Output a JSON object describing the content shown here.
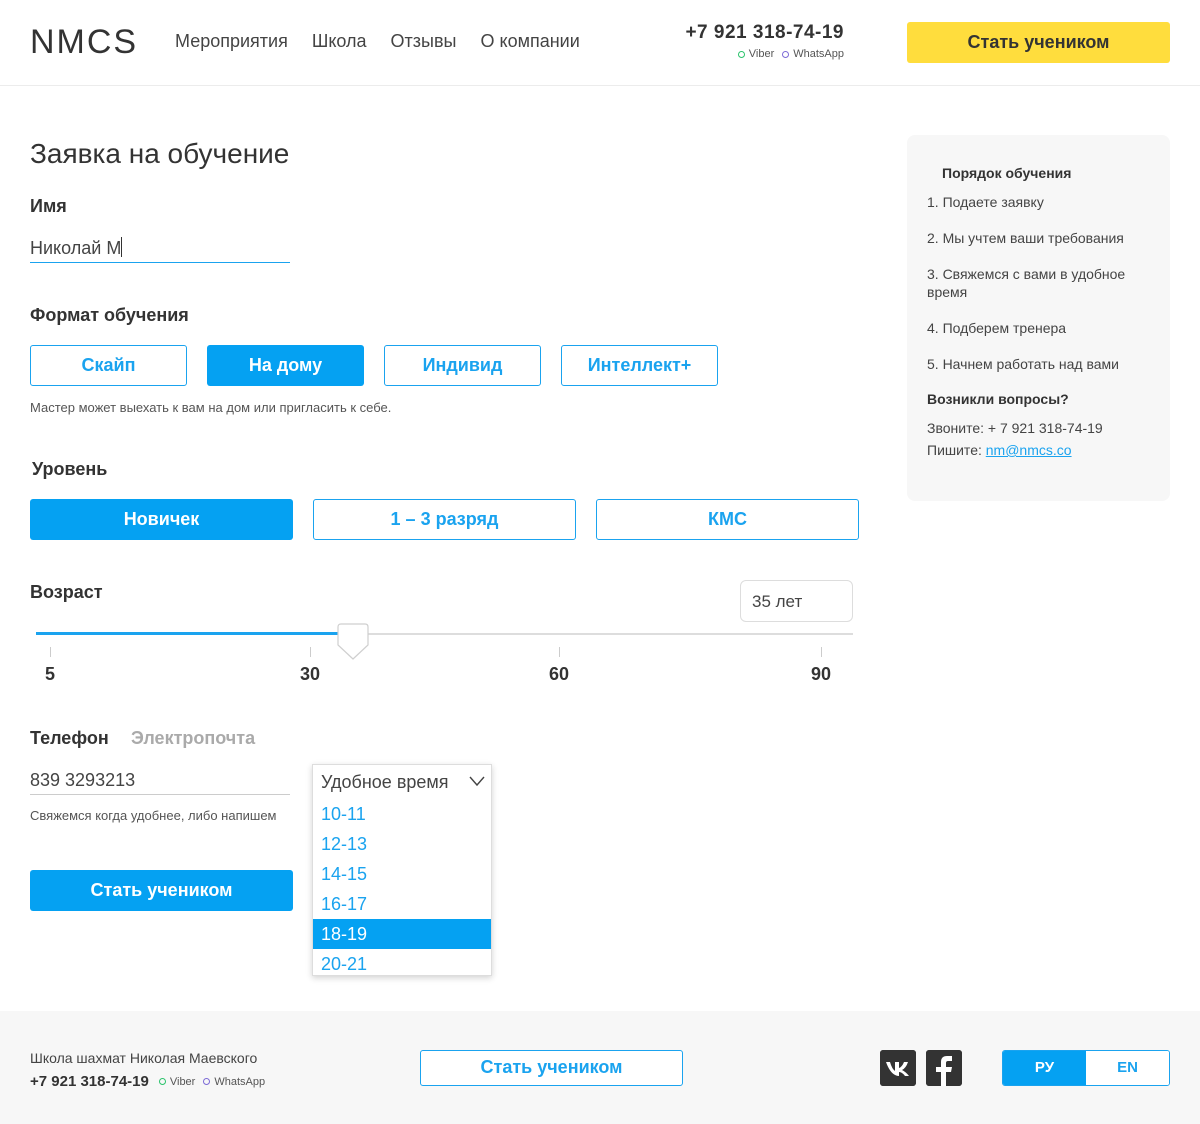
{
  "header": {
    "logo": "NMCS",
    "nav": [
      "Мероприятия",
      "Школа",
      "Отзывы",
      "О компании"
    ],
    "phone": "+7 921 318-74-19",
    "messengers": [
      "Viber",
      "WhatsApp"
    ],
    "cta": "Стать учеником"
  },
  "form": {
    "title": "Заявка на обучение",
    "name_label": "Имя",
    "name_value": "Николай М",
    "format_label": "Формат обучения",
    "formats": [
      "Скайп",
      "На дому",
      "Индивид",
      "Интеллект+"
    ],
    "format_selected": "На дому",
    "format_hint": "Мастер может выехать к вам на дом или пригласить к себе.",
    "level_label": "Уровень",
    "levels": [
      "Новичек",
      "1 – 3 разряд",
      "КМС"
    ],
    "level_selected": "Новичек",
    "age_label": "Возраст",
    "age_value": "35 лет",
    "age_ticks": [
      "5",
      "30",
      "60",
      "90"
    ],
    "contact_tab_active": "Телефон",
    "contact_tab_inactive": "Электропочта",
    "phone_value": "839 3293213",
    "contact_hint": "Свяжемся  когда удобнее, либо напишем",
    "time_placeholder": "Удобное время",
    "time_options": [
      "10-11",
      "12-13",
      "14-15",
      "16-17",
      "18-19",
      "20-21"
    ],
    "time_selected": "18-19",
    "submit": "Стать учеником"
  },
  "sidebar": {
    "title": "Порядок обучения",
    "steps": [
      "1. Подаете заявку",
      "2. Мы учтем ваши требования",
      "3. Свяжемся с вами в удобное время",
      "4. Подберем тренера",
      "5. Начнем работать над вами"
    ],
    "questions_title": "Возникли вопросы?",
    "call_label": "Звоните:",
    "call_phone": "+ 7 921 318-74-19",
    "write_label": "Пишите:",
    "email": "nm@nmcs.co"
  },
  "footer": {
    "school": "Школа шахмат Николая Маевского",
    "phone": "+7 921 318-74-19",
    "messengers": [
      "Viber",
      "WhatsApp"
    ],
    "cta": "Стать учеником",
    "social": [
      "vk-icon",
      "facebook-icon"
    ],
    "languages": [
      "РУ",
      "EN"
    ],
    "language_selected": "РУ"
  },
  "colors": {
    "accent": "#05a1f2",
    "cta_yellow": "#ffdd3d",
    "footer_bg": "#f7f7f7"
  }
}
